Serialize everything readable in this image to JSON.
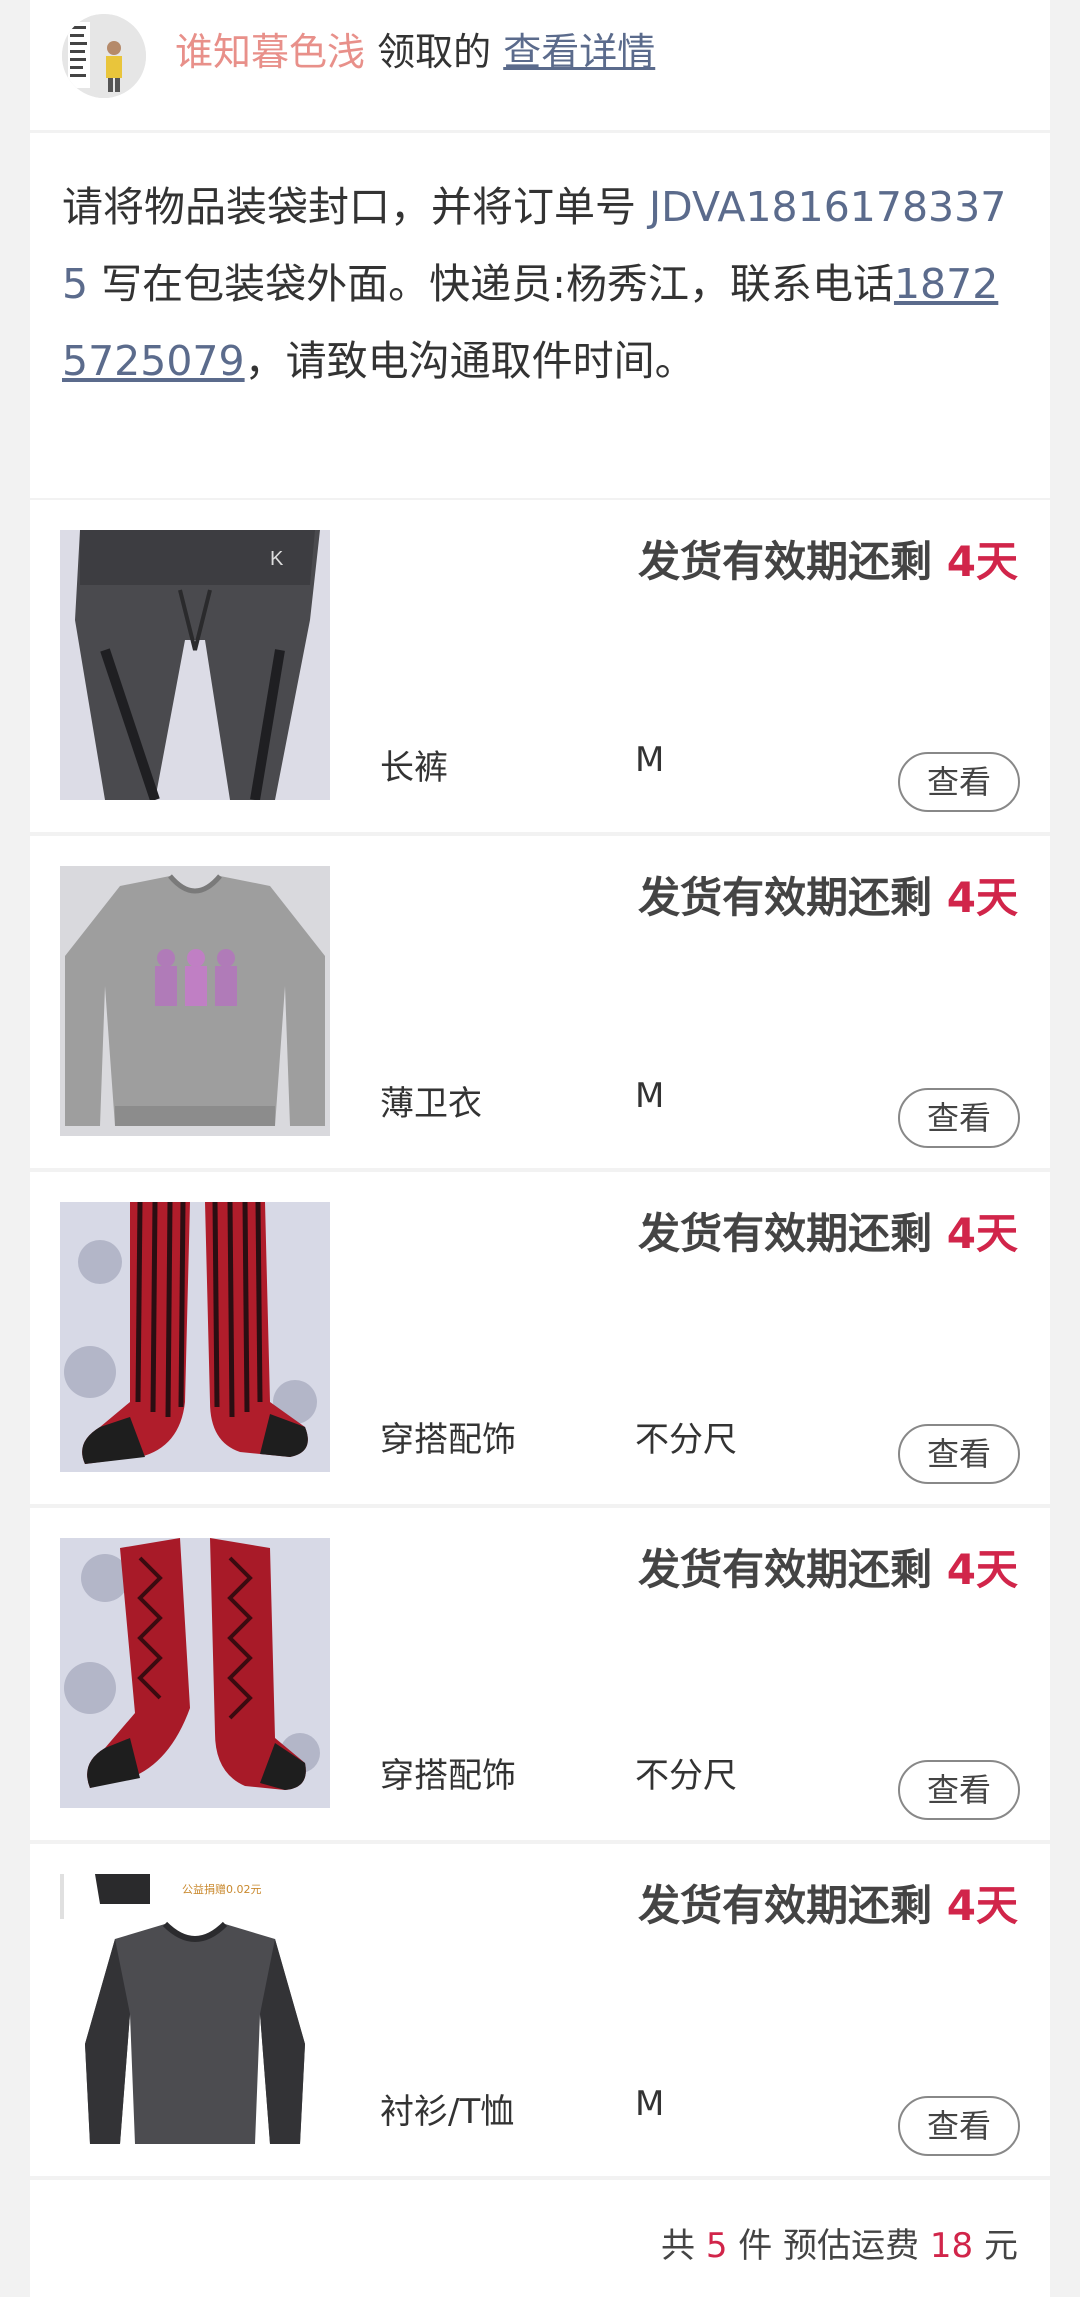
{
  "header": {
    "receiver_name": "谁知暮色浅",
    "claimed_text": "领取的",
    "details_link": "查看详情"
  },
  "notice": {
    "part1": "请将物品装袋封口，并将订单号 ",
    "order_number": "JDVA18161783375",
    "part2": " 写在包装袋外面。快递员:杨秀江，联系电话",
    "phone": "18725725079",
    "part3": "，请致电沟通取件时间。"
  },
  "items": [
    {
      "deadline_label": "发货有效期还剩",
      "days": "4天",
      "name": "长裤",
      "size": "M",
      "view_label": "查看",
      "thumb_icon": "pants-photo"
    },
    {
      "deadline_label": "发货有效期还剩",
      "days": "4天",
      "name": "薄卫衣",
      "size": "M",
      "view_label": "查看",
      "thumb_icon": "sweatshirt-photo"
    },
    {
      "deadline_label": "发货有效期还剩",
      "days": "4天",
      "name": "穿搭配饰",
      "size": "不分尺",
      "view_label": "查看",
      "thumb_icon": "striped-socks-photo"
    },
    {
      "deadline_label": "发货有效期还剩",
      "days": "4天",
      "name": "穿搭配饰",
      "size": "不分尺",
      "view_label": "查看",
      "thumb_icon": "patterned-socks-photo"
    },
    {
      "deadline_label": "发货有效期还剩",
      "days": "4天",
      "name": "衬衫/T恤",
      "size": "M",
      "view_label": "查看",
      "thumb_icon": "tshirt-photo",
      "thumb_tag": "公益捐赠0.02元"
    }
  ],
  "summary": {
    "prefix": "共 ",
    "count": "5",
    "mid": " 件 预估运费 ",
    "fee": "18",
    "suffix": " 元"
  },
  "colors": {
    "accent": "#d1254a",
    "link": "#5b6b8c",
    "receiver": "#e8908a"
  }
}
